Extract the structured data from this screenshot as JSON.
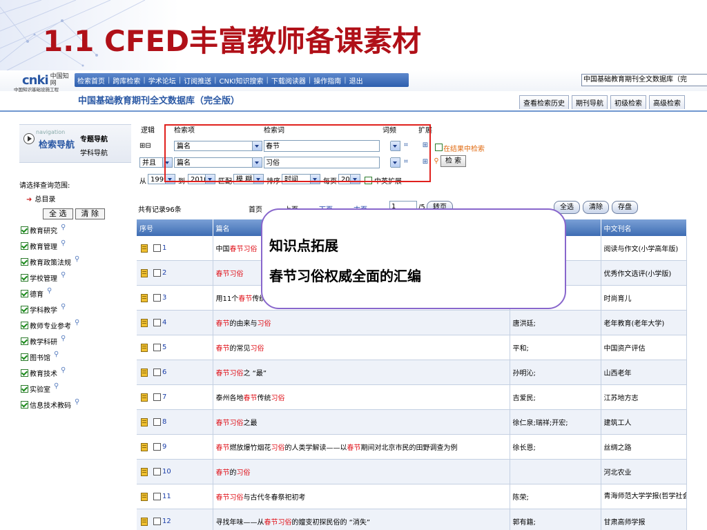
{
  "slide": {
    "title": "1.1  CFED丰富教师备课素材"
  },
  "app": {
    "logo_text": "cnki",
    "logo_cn": "中国知网",
    "logo_sub": "中国知识基础设施工程",
    "nav": [
      "检索首页",
      "跨库检索",
      "学术论坛",
      "订阅推送",
      "CNKI知识搜索",
      "下载阅读器",
      "操作指南",
      "退出"
    ],
    "db_select": "中国基础教育期刊全文数据库（完",
    "db_title": "中国基础教育期刊全文数据库（完全版）",
    "tabs": [
      "查看检索历史",
      "期刊导航",
      "初级检索",
      "高级检索"
    ]
  },
  "left": {
    "nav_eng": "navigation",
    "nav_cn": "检索导航",
    "topic_nav": "专题导航",
    "subject_nav": "学科导航",
    "scope_label": "请选择查询范围:",
    "catalog": "总目录",
    "select_all": "全 选",
    "clear": "清 除",
    "categories": [
      "教育研究",
      "教育管理",
      "教育政策法规",
      "学校管理",
      "德育",
      "学科教学",
      "教师专业参考",
      "教学科研",
      "图书馆",
      "教育技术",
      "实验室",
      "信息技术教码"
    ]
  },
  "search": {
    "headers": {
      "logic": "逻辑",
      "field": "检索项",
      "term": "检索词",
      "freq": "词频",
      "expand": "扩展"
    },
    "row1": {
      "plusminus": "⊞⊟",
      "field": "篇名",
      "term": "春节"
    },
    "row2": {
      "logic": "并且",
      "field": "篇名",
      "term": "习俗"
    },
    "in_results": "在结果中检索",
    "search_btn": "检 索",
    "range": {
      "from_label": "从",
      "from": "1999",
      "to_label": "到",
      "to": "2010",
      "match_label": "匹配",
      "match": "模 糊",
      "sort_label": "排序",
      "sort": "时间",
      "per_page_label": "每页",
      "per_page": "20",
      "cn_en": "中英扩展"
    }
  },
  "results": {
    "count": "共有记录96条",
    "first": "首页",
    "prev": "上页",
    "next": "下页",
    "last": "末页",
    "page_value": "1",
    "page_total": "/5",
    "goto": "转页",
    "select_all": "全选",
    "clear": "清除",
    "save": "存盘",
    "columns": [
      "序号",
      "篇名",
      "作者",
      "中文刊名"
    ],
    "rows": [
      {
        "n": "1",
        "title_parts": [
          {
            "t": "中国",
            "h": false
          },
          {
            "t": "春节",
            "h": true
          },
          {
            "t": "习俗",
            "h": true
          }
        ],
        "author": "",
        "journal": "阅读与作文(小学高年版)"
      },
      {
        "n": "2",
        "title_parts": [
          {
            "t": "春节",
            "h": true
          },
          {
            "t": "习俗",
            "h": true
          }
        ],
        "author": "",
        "journal": "优秀作文选评(小学版)"
      },
      {
        "n": "3",
        "title_parts": [
          {
            "t": "用11个",
            "h": false
          },
          {
            "t": "春节",
            "h": true
          },
          {
            "t": "传统",
            "h": false
          }
        ],
        "author": "",
        "journal": "时尚育儿"
      },
      {
        "n": "4",
        "title_parts": [
          {
            "t": "春节",
            "h": true
          },
          {
            "t": "的由来与",
            "h": false
          },
          {
            "t": "习俗",
            "h": true
          }
        ],
        "author": "唐洪廷;",
        "journal": "老年教育(老年大学)"
      },
      {
        "n": "5",
        "title_parts": [
          {
            "t": "春节",
            "h": true
          },
          {
            "t": "的常见",
            "h": false
          },
          {
            "t": "习俗",
            "h": true
          }
        ],
        "author": "平和;",
        "journal": "中国资产评估"
      },
      {
        "n": "6",
        "title_parts": [
          {
            "t": "春节",
            "h": true
          },
          {
            "t": "习俗",
            "h": true
          },
          {
            "t": "之 “最”",
            "h": false
          }
        ],
        "author": "孙明沁;",
        "journal": "山西老年"
      },
      {
        "n": "7",
        "title_parts": [
          {
            "t": "泰州各地",
            "h": false
          },
          {
            "t": "春节",
            "h": true
          },
          {
            "t": "传统",
            "h": false
          },
          {
            "t": "习俗",
            "h": true
          }
        ],
        "author": "吉爱民;",
        "journal": "江苏地方志"
      },
      {
        "n": "8",
        "title_parts": [
          {
            "t": "春节",
            "h": true
          },
          {
            "t": "习俗",
            "h": true
          },
          {
            "t": "之最",
            "h": false
          }
        ],
        "author": "徐仁泉;瑞祥;开宏;",
        "journal": "建筑工人"
      },
      {
        "n": "9",
        "title_parts": [
          {
            "t": "春节",
            "h": true
          },
          {
            "t": "燃放爆竹烟花",
            "h": false
          },
          {
            "t": "习俗",
            "h": true
          },
          {
            "t": "的人类学解读——以",
            "h": false
          },
          {
            "t": "春节",
            "h": true
          },
          {
            "t": "期间对北京市民的田野调查为例",
            "h": false
          }
        ],
        "author": "徐长恩;",
        "journal": "丝绸之路"
      },
      {
        "n": "10",
        "title_parts": [
          {
            "t": "春节",
            "h": true
          },
          {
            "t": "的",
            "h": false
          },
          {
            "t": "习俗",
            "h": true
          }
        ],
        "author": "",
        "journal": "河北农业"
      },
      {
        "n": "11",
        "title_parts": [
          {
            "t": "春节",
            "h": true
          },
          {
            "t": "习俗",
            "h": true
          },
          {
            "t": "与古代冬春祭祀初考",
            "h": false
          }
        ],
        "author": "陈荣;",
        "journal": "青海师范大学学报(哲学社会科学版)"
      },
      {
        "n": "12",
        "title_parts": [
          {
            "t": "寻找年味——从",
            "h": false
          },
          {
            "t": "春节",
            "h": true
          },
          {
            "t": "习俗",
            "h": true
          },
          {
            "t": "的嬗变初探民俗的 “消失”",
            "h": false
          }
        ],
        "author": "郭有籍;",
        "journal": "甘肃高师学报"
      }
    ]
  },
  "callout": {
    "line1": "知识点拓展",
    "line2": "春节习俗权威全面的汇编"
  },
  "colors": {
    "title_red": "#b01018",
    "nav_blue": "#2a58a4",
    "highlight_red": "#e0141c",
    "link_blue": "#1a3ea8",
    "callout_border": "#8866cc",
    "box_red": "#e0201c"
  }
}
